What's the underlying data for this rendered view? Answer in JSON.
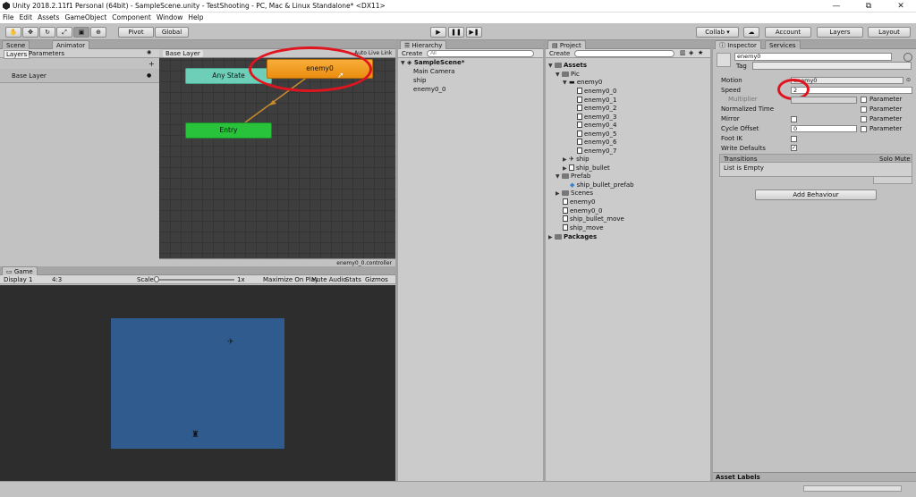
{
  "window": {
    "title": "Unity 2018.2.11f1 Personal (64bit) - SampleScene.unity - TestShooting - PC, Mac & Linux Standalone* <DX11>",
    "minimize": "—",
    "restore": "⧉",
    "close": "✕"
  },
  "menu": [
    "File",
    "Edit",
    "Assets",
    "GameObject",
    "Component",
    "Window",
    "Help"
  ],
  "toolbar": {
    "pivot": "Pivot",
    "global": "Global",
    "collab": "Collab ▾",
    "account": "Account",
    "layers": "Layers",
    "layout": "Layout"
  },
  "animator": {
    "tabs": [
      "Scene",
      "Animator"
    ],
    "subtabs": [
      "Layers",
      "Parameters"
    ],
    "base_layer_label": "Base Layer",
    "breadcrumb": "Base Layer",
    "autolive": "Auto Live Link",
    "states": {
      "any_state": "Any State",
      "enemy0": "enemy0",
      "entry": "Entry"
    },
    "controller_file": "enemy0_0.controller"
  },
  "game": {
    "tab": "Game",
    "display": "Display 1",
    "aspect": "4:3",
    "scale_label": "Scale",
    "scale_value": "1x",
    "buttons": [
      "Maximize On Play",
      "Mute Audio",
      "Stats",
      "Gizmos"
    ],
    "scene_color": "#2f5b8f"
  },
  "hierarchy": {
    "tab": "Hierarchy",
    "create": "Create",
    "search_placeholder": "All",
    "scene": "SampleScene*",
    "items": [
      "Main Camera",
      "ship",
      "enemy0_0"
    ]
  },
  "project": {
    "tab": "Project",
    "create": "Create",
    "assets": "Assets",
    "pic": "Pic",
    "enemy0": "enemy0",
    "frames": [
      "enemy0_0",
      "enemy0_1",
      "enemy0_2",
      "enemy0_3",
      "enemy0_4",
      "enemy0_5",
      "enemy0_6",
      "enemy0_7"
    ],
    "ship": "ship",
    "ship_bullet": "ship_bullet",
    "prefab": "Prefab",
    "ship_bullet_prefab": "ship_bullet_prefab",
    "scenes": "Scenes",
    "files": [
      "enemy0",
      "enemy0_0",
      "ship_bullet_move",
      "ship_move"
    ],
    "packages": "Packages"
  },
  "inspector": {
    "tabs": [
      "Inspector",
      "Services"
    ],
    "name": "enemy0",
    "tag_label": "Tag",
    "motion_label": "Motion",
    "motion_value": "enemy0",
    "speed_label": "Speed",
    "speed_value": "2",
    "multiplier_label": "Multiplier",
    "param_label": "Parameter",
    "normalized_time_label": "Normalized Time",
    "mirror_label": "Mirror",
    "cycle_offset_label": "Cycle Offset",
    "cycle_offset_value": "0",
    "foot_ik_label": "Foot IK",
    "write_defaults_label": "Write Defaults",
    "transitions_label": "Transitions",
    "solo_mute": "Solo Mute",
    "list_empty": "List is Empty",
    "add_behaviour": "Add Behaviour",
    "asset_labels": "Asset Labels"
  },
  "colors": {
    "any_state": "#6ecfb8",
    "enemy0_state": "#f29a1c",
    "entry_state": "#28c33a",
    "highlight_ring": "#e0141e"
  }
}
